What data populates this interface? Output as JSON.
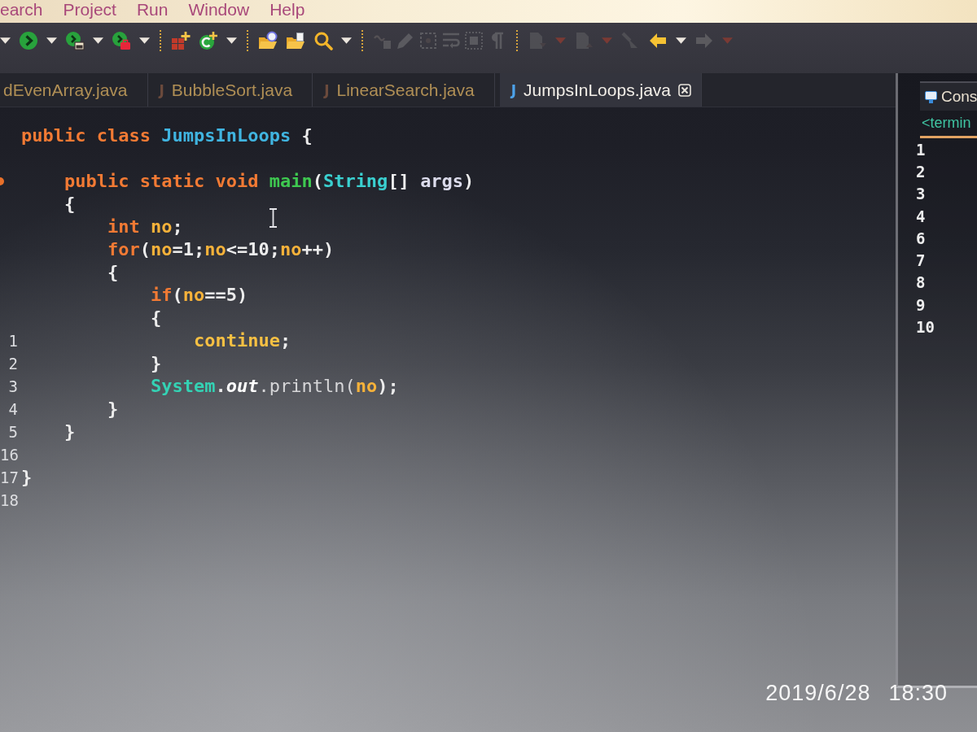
{
  "menu_bar": {
    "items": [
      "earch",
      "Project",
      "Run",
      "Window",
      "Help"
    ]
  },
  "toolbar": {
    "groups": [
      {
        "buttons": [
          {
            "dropdown": true,
            "disabled": false
          },
          {
            "dropdown": true,
            "disabled": false
          },
          {
            "dropdown": true,
            "disabled": false
          },
          {
            "dropdown": true,
            "disabled": false
          }
        ]
      },
      {
        "buttons": [
          {
            "disabled": false
          },
          {
            "dropdown": true,
            "disabled": false
          }
        ]
      },
      {
        "buttons": [
          {
            "disabled": false
          },
          {
            "disabled": false
          },
          {
            "dropdown": true,
            "disabled": false
          }
        ]
      },
      {
        "buttons": [
          {
            "disabled": true
          },
          {
            "disabled": true
          },
          {
            "disabled": true
          },
          {
            "disabled": true
          },
          {
            "disabled": true
          },
          {
            "disabled": true
          }
        ]
      },
      {
        "buttons": [
          {
            "dropdown": true,
            "disabled": true
          },
          {
            "dropdown": true,
            "disabled": true
          },
          {
            "disabled": true
          },
          {
            "dropdown": true,
            "disabled": false
          },
          {
            "dropdown": true,
            "disabled": true
          }
        ]
      }
    ]
  },
  "editor": {
    "tabs": [
      {
        "label": "dEvenArray.java",
        "selected": false
      },
      {
        "icon": "J",
        "label": "BubbleSort.java",
        "selected": false
      },
      {
        "icon": "J",
        "label": "LinearSearch.java",
        "selected": false
      },
      {
        "icon": "J",
        "label": "JumpsInLoops.java",
        "selected": true
      }
    ],
    "lines": [
      {
        "kind": "code",
        "tokens": [
          {
            "text": "public ",
            "kind": "keyword"
          },
          {
            "text": "class ",
            "kind": "keyword"
          },
          {
            "text": "JumpsInLoops ",
            "kind": "class"
          },
          {
            "text": "{",
            "kind": "punct"
          }
        ]
      },
      {
        "kind": "blank"
      },
      {
        "kind": "code",
        "marker": true,
        "tokens": [
          {
            "text": "    public ",
            "kind": "keyword"
          },
          {
            "text": "static ",
            "kind": "keyword"
          },
          {
            "text": "void ",
            "kind": "keyword"
          },
          {
            "text": "main",
            "kind": "method"
          },
          {
            "text": "(",
            "kind": "punct"
          },
          {
            "text": "String",
            "kind": "type"
          },
          {
            "text": "[] ",
            "kind": "punct"
          },
          {
            "text": "args",
            "kind": "param"
          },
          {
            "text": ")",
            "kind": "punct"
          }
        ]
      },
      {
        "kind": "code",
        "tokens": [
          {
            "text": "    {",
            "kind": "punct"
          }
        ]
      },
      {
        "kind": "code",
        "tokens": [
          {
            "text": "        int ",
            "kind": "keyword"
          },
          {
            "text": "no",
            "kind": "local"
          },
          {
            "text": ";",
            "kind": "punct"
          }
        ]
      },
      {
        "kind": "code",
        "tokens": [
          {
            "text": "        for",
            "kind": "keyword"
          },
          {
            "text": "(",
            "kind": "punct"
          },
          {
            "text": "no",
            "kind": "local"
          },
          {
            "text": "=",
            "kind": "punct"
          },
          {
            "text": "1",
            "kind": "number"
          },
          {
            "text": ";",
            "kind": "punct"
          },
          {
            "text": "no",
            "kind": "local"
          },
          {
            "text": "<=",
            "kind": "punct"
          },
          {
            "text": "10",
            "kind": "number"
          },
          {
            "text": ";",
            "kind": "punct"
          },
          {
            "text": "no",
            "kind": "local"
          },
          {
            "text": "++)",
            "kind": "punct"
          }
        ]
      },
      {
        "kind": "code",
        "tokens": [
          {
            "text": "        {",
            "kind": "punct"
          }
        ]
      },
      {
        "kind": "code",
        "tokens": [
          {
            "text": "            if",
            "kind": "keyword"
          },
          {
            "text": "(",
            "kind": "punct"
          },
          {
            "text": "no",
            "kind": "local"
          },
          {
            "text": "==",
            "kind": "punct"
          },
          {
            "text": "5",
            "kind": "number"
          },
          {
            "text": ")",
            "kind": "punct"
          }
        ]
      },
      {
        "kind": "code",
        "tokens": [
          {
            "text": "            {",
            "kind": "punct"
          }
        ]
      },
      {
        "kind": "code",
        "number": "1",
        "tokens": [
          {
            "text": "                continue",
            "kind": "jump"
          },
          {
            "text": ";",
            "kind": "punct"
          }
        ]
      },
      {
        "kind": "code",
        "number": "2",
        "tokens": [
          {
            "text": "            }",
            "kind": "punct"
          }
        ]
      },
      {
        "kind": "code",
        "number": "3",
        "tokens": [
          {
            "text": "            System",
            "kind": "class_ref"
          },
          {
            "text": ".",
            "kind": "punct"
          },
          {
            "text": "out",
            "kind": "field"
          },
          {
            "text": ".println(",
            "kind": "call"
          },
          {
            "text": "no",
            "kind": "local"
          },
          {
            "text": ");",
            "kind": "punct"
          }
        ]
      },
      {
        "kind": "code",
        "number": "4",
        "tokens": [
          {
            "text": "        }",
            "kind": "punct"
          }
        ]
      },
      {
        "kind": "code",
        "number": "5",
        "tokens": [
          {
            "text": "    }",
            "kind": "punct"
          }
        ]
      },
      {
        "kind": "blank",
        "number": "16"
      },
      {
        "kind": "code",
        "number": "17",
        "tokens": [
          {
            "text": "}",
            "kind": "punct"
          }
        ]
      },
      {
        "kind": "blank",
        "number": "18"
      }
    ]
  },
  "console": {
    "tab": {
      "label": "Cons"
    },
    "header": "<termin",
    "output": [
      "1",
      "2",
      "3",
      "4",
      "6",
      "7",
      "8",
      "9",
      "10"
    ]
  },
  "photo_stamp": {
    "date": "2019/6/28",
    "time": "18:30"
  }
}
